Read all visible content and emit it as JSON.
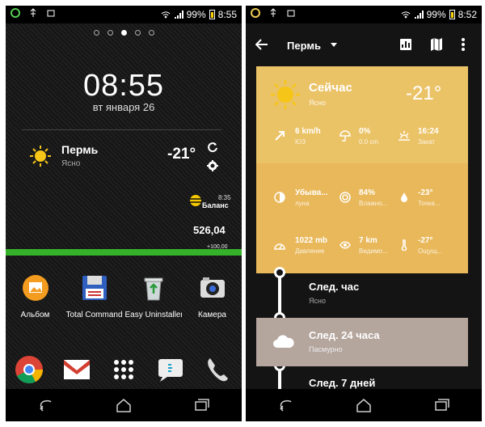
{
  "left": {
    "statusbar": {
      "battery": "99%",
      "time": "8:55"
    },
    "clock": "08:55",
    "date": "вт января 26",
    "weather": {
      "city": "Пермь",
      "condition": "Ясно",
      "temperature": "-21°"
    },
    "balance": {
      "time": "8:35",
      "label": "Баланс",
      "amount": "526,04",
      "delta": "+100,00"
    },
    "apps": [
      {
        "label": "Альбом",
        "icon": "album-icon"
      },
      {
        "label": "Total Commander",
        "icon": "floppy-icon"
      },
      {
        "label": "Easy Uninstaller",
        "icon": "recycle-icon"
      },
      {
        "label": "Камера",
        "icon": "camera-icon"
      }
    ],
    "dock": [
      "chrome-icon",
      "gmail-icon",
      "app-drawer-icon",
      "sms-icon",
      "phone-icon"
    ]
  },
  "right": {
    "statusbar": {
      "battery": "99%",
      "time": "8:52"
    },
    "appbar": {
      "title": "Пермь"
    },
    "now": {
      "label": "Сейчас",
      "condition": "Ясно",
      "temperature": "-21°",
      "wind": {
        "value": "6 km/h",
        "sub": "ЮЗ"
      },
      "precip": {
        "value": "0%",
        "sub": "0.0 cm"
      },
      "sunset": {
        "value": "16:24",
        "sub": "Закат"
      },
      "moon": {
        "value": "Убыва...",
        "sub": "луна"
      },
      "humidity": {
        "value": "84%",
        "sub": "Влажно..."
      },
      "dewpoint": {
        "value": "-23°",
        "sub": "Точка..."
      },
      "pressure": {
        "value": "1022 mb",
        "sub": "Давление"
      },
      "visibility": {
        "value": "7 km",
        "sub": "Видимо..."
      },
      "feels": {
        "value": "-27°",
        "sub": "Ощущ..."
      }
    },
    "next_hour": {
      "label": "След. час",
      "condition": "Ясно"
    },
    "next_24": {
      "label": "След. 24 часа",
      "condition": "Пасмурно"
    },
    "next_7": {
      "label": "След. 7 дней"
    }
  },
  "colors": {
    "card_gold": "#e9b85a",
    "card_taupe": "#b4a59d",
    "accent_green": "#35b12a"
  }
}
